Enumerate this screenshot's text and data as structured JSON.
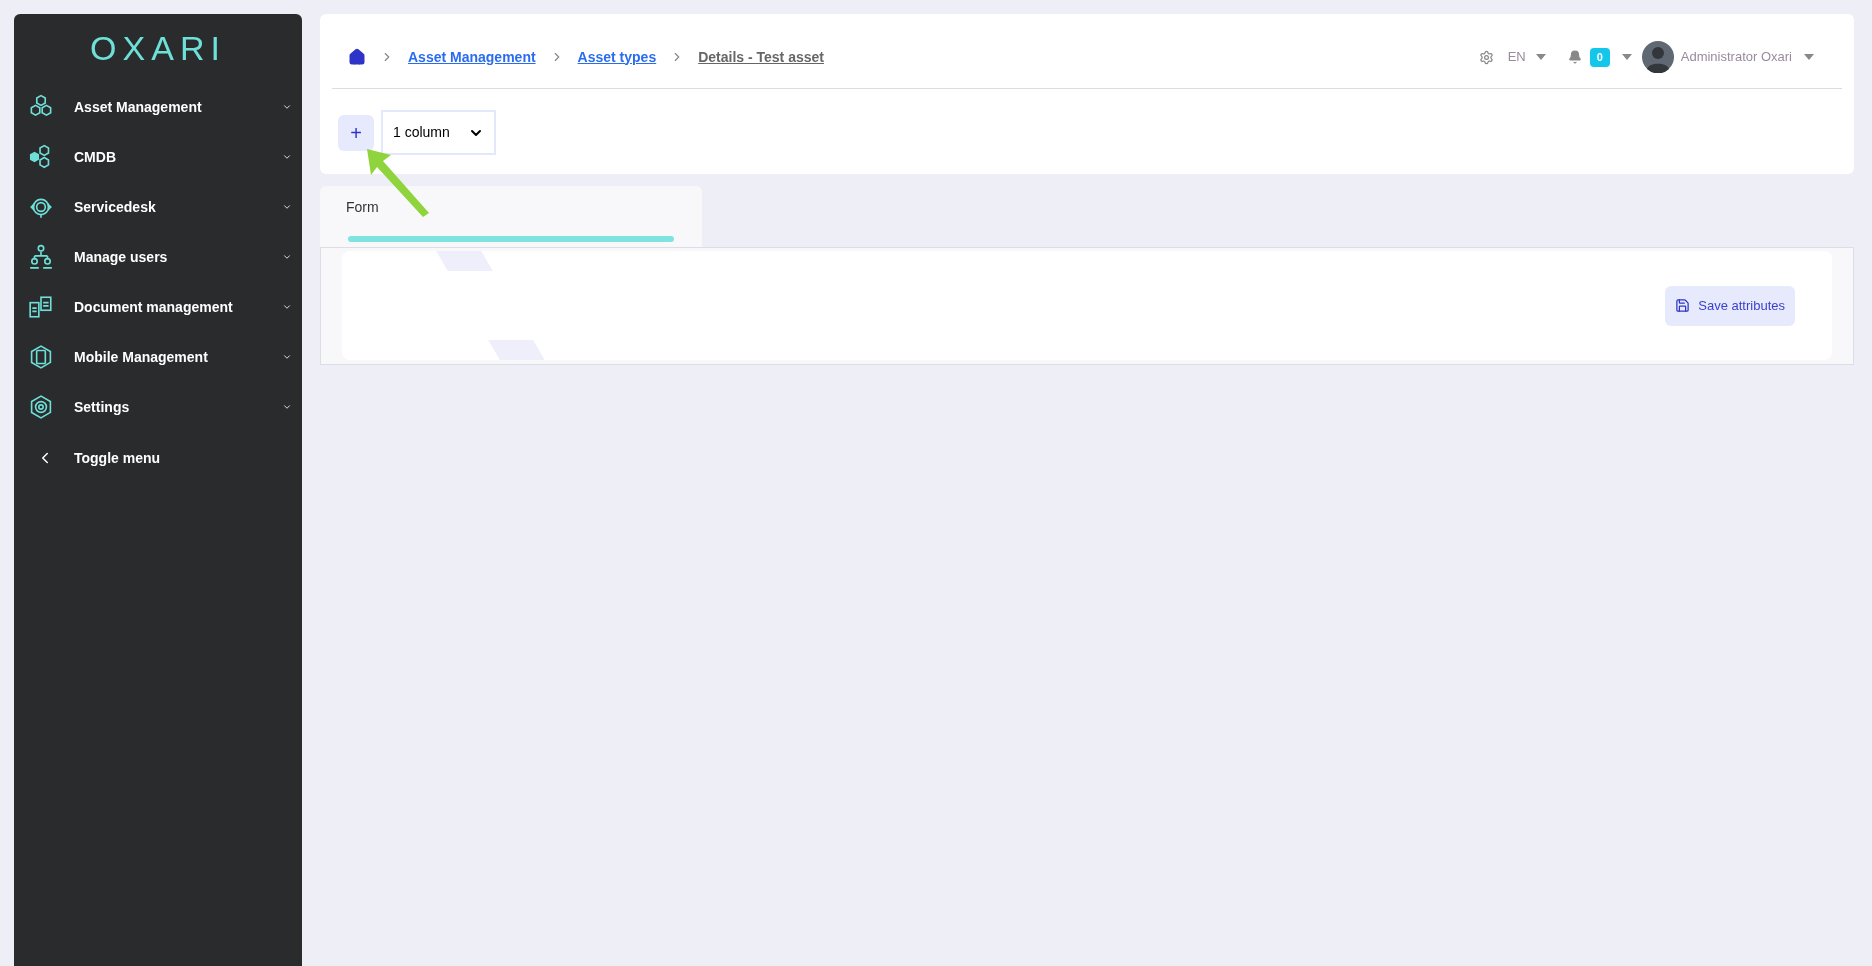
{
  "sidebar": {
    "logo": "OXARI",
    "items": [
      {
        "label": "Asset Management",
        "expanded": false
      },
      {
        "label": "CMDB",
        "expanded": false
      },
      {
        "label": "Servicedesk",
        "expanded": false
      },
      {
        "label": "Manage users",
        "expanded": false
      },
      {
        "label": "Document management",
        "expanded": false
      },
      {
        "label": "Mobile Management",
        "expanded": false
      },
      {
        "label": "Settings",
        "expanded": false
      }
    ],
    "toggle": "Toggle menu"
  },
  "breadcrumb": [
    {
      "label": "Asset Management",
      "current": false
    },
    {
      "label": "Asset types",
      "current": false
    },
    {
      "label": "Details - Test asset",
      "current": true
    }
  ],
  "header": {
    "language": "EN",
    "notifications": "0",
    "user": "Administrator Oxari"
  },
  "toolbar": {
    "add": "+",
    "columns": "1 column"
  },
  "tabs": [
    {
      "label": "Form",
      "selected": true
    }
  ],
  "save_button": "Save attributes"
}
